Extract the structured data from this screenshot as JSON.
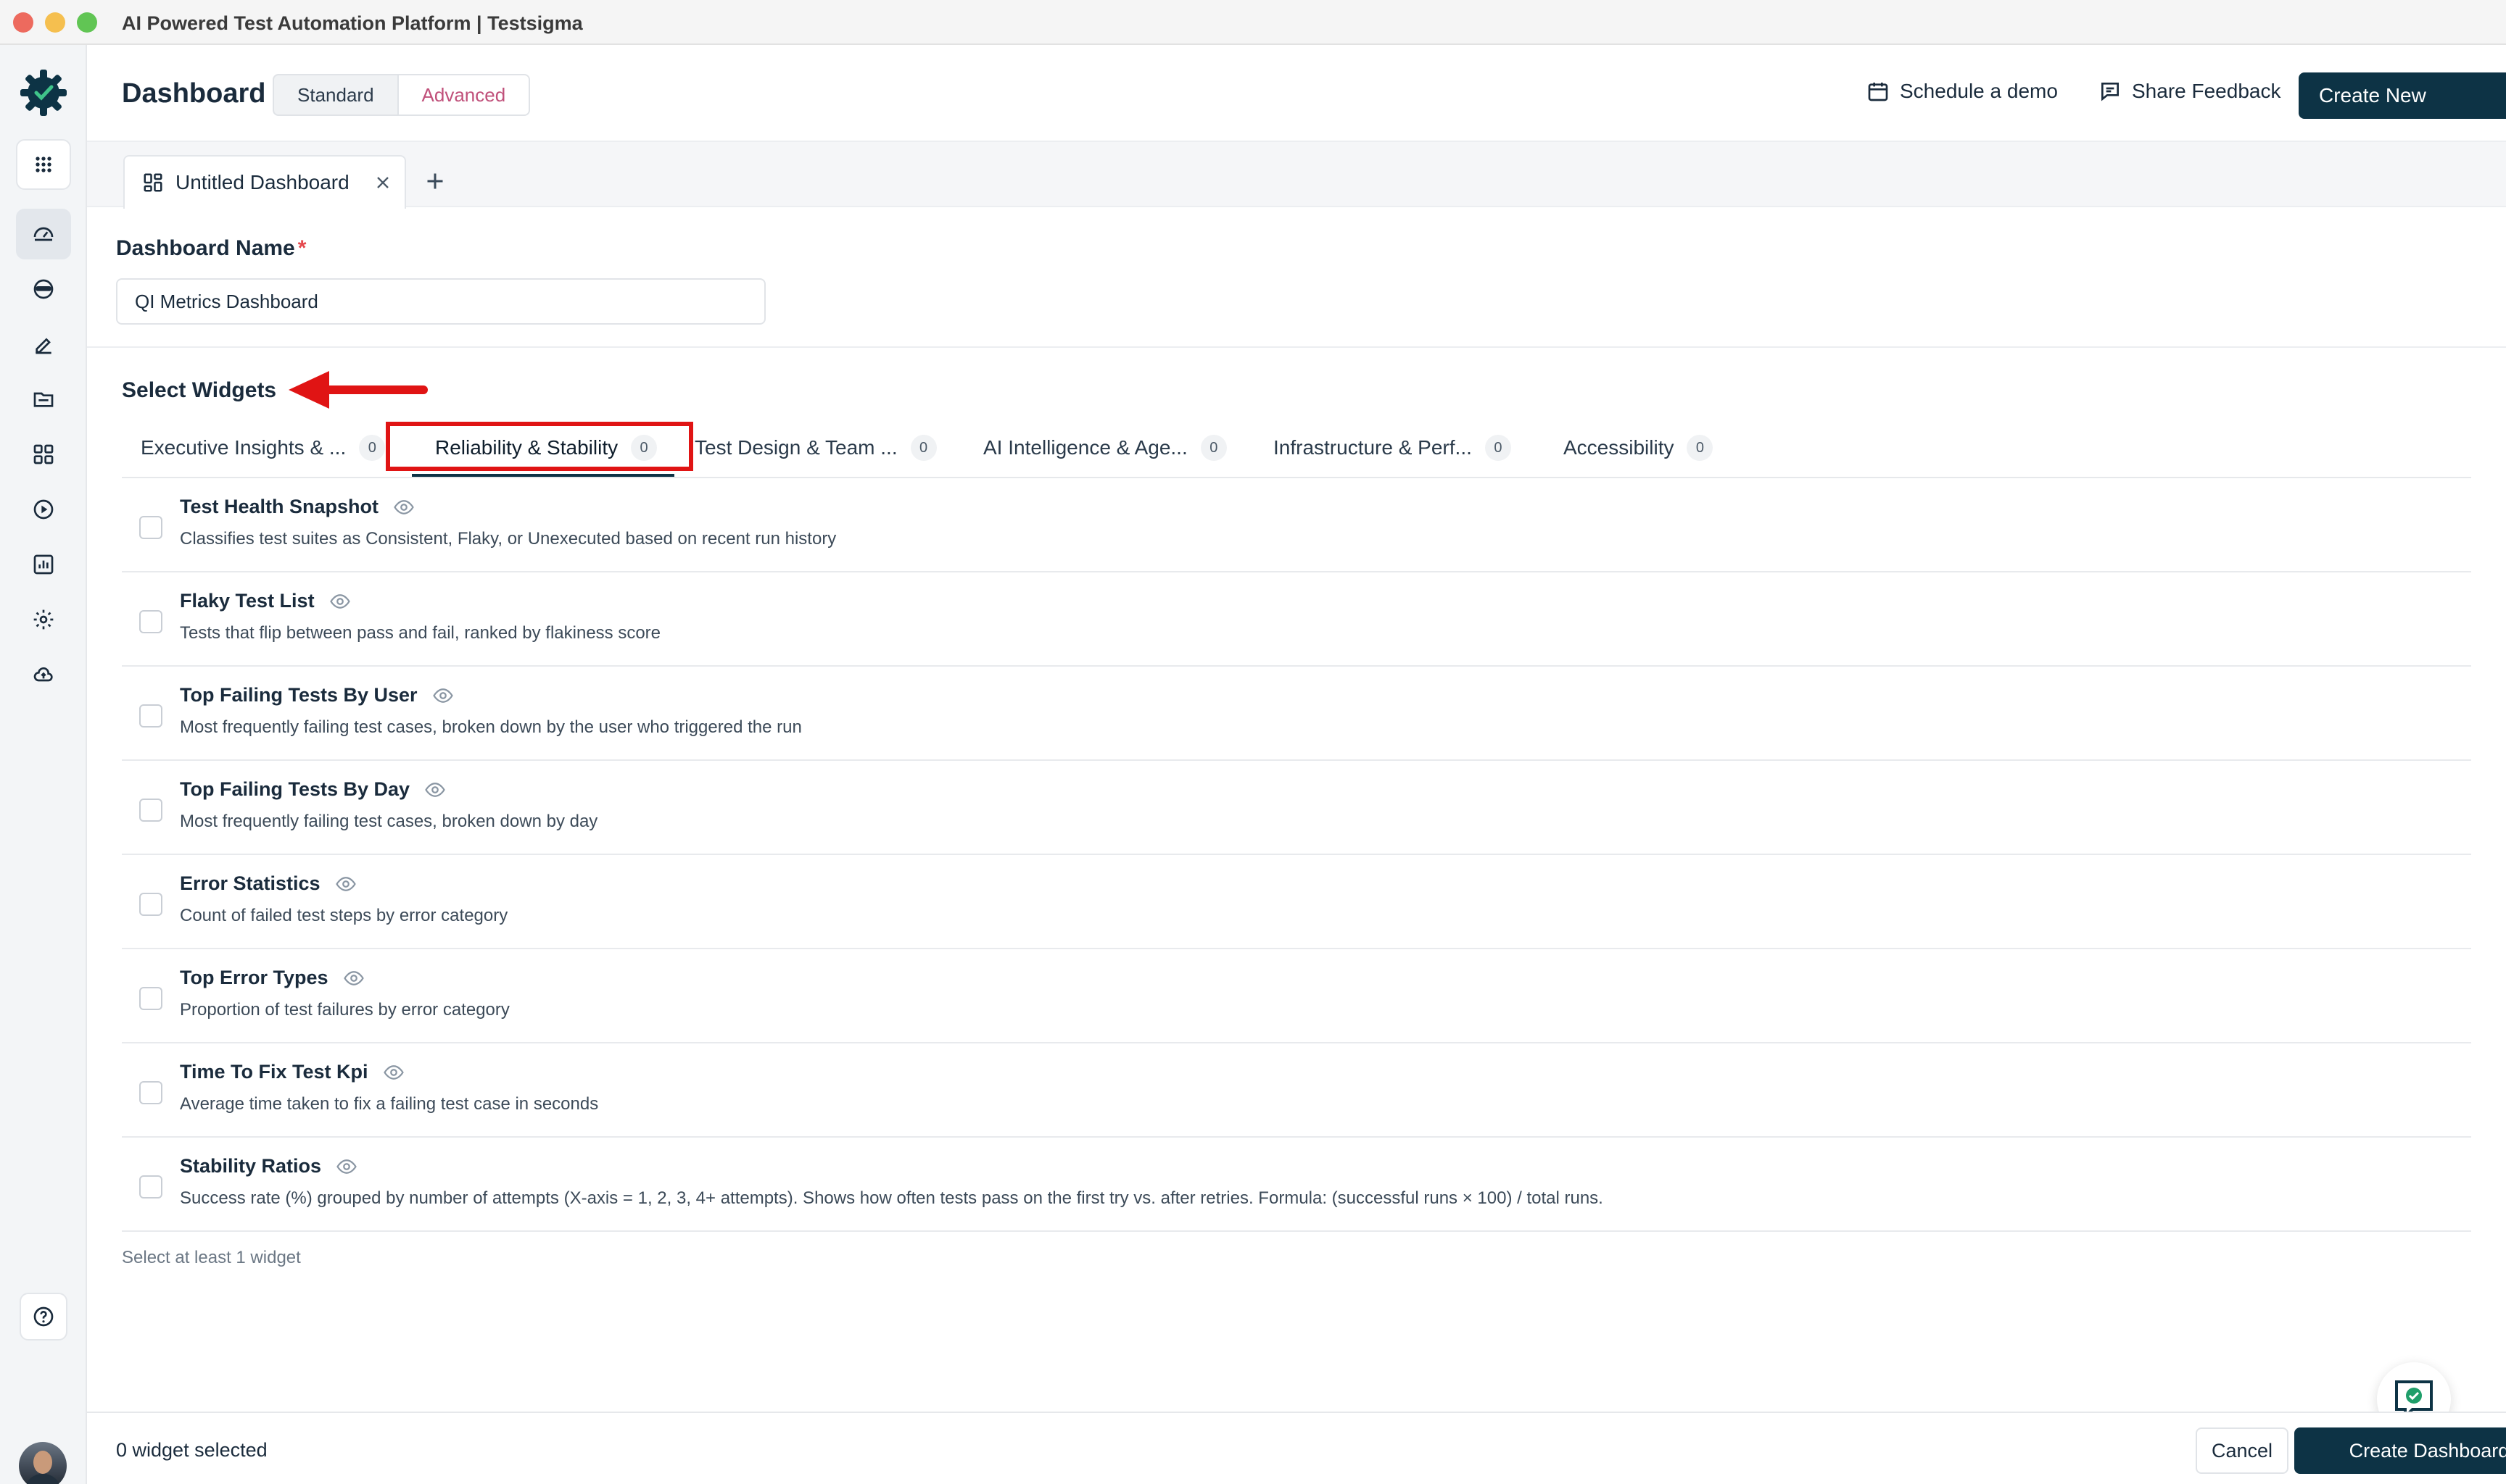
{
  "window": {
    "title": "AI Powered Test Automation Platform | Testsigma"
  },
  "header": {
    "title": "Dashboard",
    "view_modes": [
      "Standard",
      "Advanced"
    ],
    "active_view": "Advanced",
    "schedule_demo": "Schedule a demo",
    "share_feedback": "Share Feedback",
    "create_new": "Create New"
  },
  "tabs": {
    "current": "Untitled Dashboard"
  },
  "form": {
    "name_label": "Dashboard Name",
    "required_mark": "*",
    "name_value": "QI Metrics Dashboard"
  },
  "widgets_section": {
    "title": "Select Widgets",
    "categories": [
      {
        "label": "Executive Insights & ...",
        "count": "0"
      },
      {
        "label": "Reliability & Stability",
        "count": "0"
      },
      {
        "label": "Test Design & Team ...",
        "count": "0"
      },
      {
        "label": "AI Intelligence & Age...",
        "count": "0"
      },
      {
        "label": "Infrastructure & Perf...",
        "count": "0"
      },
      {
        "label": "Accessibility",
        "count": "0"
      }
    ],
    "active_category": "Reliability & Stability",
    "items": [
      {
        "title": "Test Health Snapshot",
        "description": "Classifies test suites as Consistent, Flaky, or Unexecuted based on recent run history"
      },
      {
        "title": "Flaky Test List",
        "description": "Tests that flip between pass and fail, ranked by flakiness score"
      },
      {
        "title": "Top Failing Tests By User",
        "description": "Most frequently failing test cases, broken down by the user who triggered the run"
      },
      {
        "title": "Top Failing Tests By Day",
        "description": "Most frequently failing test cases, broken down by day"
      },
      {
        "title": "Error Statistics",
        "description": "Count of failed test steps by error category"
      },
      {
        "title": "Top Error Types",
        "description": "Proportion of test failures by error category"
      },
      {
        "title": "Time To Fix Test Kpi",
        "description": "Average time taken to fix a failing test case in seconds"
      },
      {
        "title": "Stability Ratios",
        "description": "Success rate (%) grouped by number of attempts (X-axis = 1, 2, 3, 4+ attempts). Shows how often tests pass on the first try vs. after retries. Formula: (successful runs × 100) / total runs."
      }
    ],
    "hint": "Select at least 1 widget"
  },
  "footer": {
    "selected_count": "0 widget selected",
    "cancel": "Cancel",
    "create": "Create Dashboard"
  },
  "colors": {
    "primary": "#0d3345",
    "highlight": "#e01414",
    "accent": "#c0507a"
  },
  "icons": [
    "testsigma-logo-icon",
    "apps-grid-icon",
    "dashboard-gauge-icon",
    "test-runner-icon",
    "edit-pen-icon",
    "folder-icon",
    "widgets-grid-icon",
    "play-circle-icon",
    "bar-chart-icon",
    "gear-icon",
    "cloud-upload-icon",
    "help-circle-icon",
    "calendar-icon",
    "feedback-icon",
    "chevron-down-icon",
    "dashboard-tab-icon",
    "close-icon",
    "plus-icon",
    "eye-icon",
    "chat-bot-icon"
  ]
}
